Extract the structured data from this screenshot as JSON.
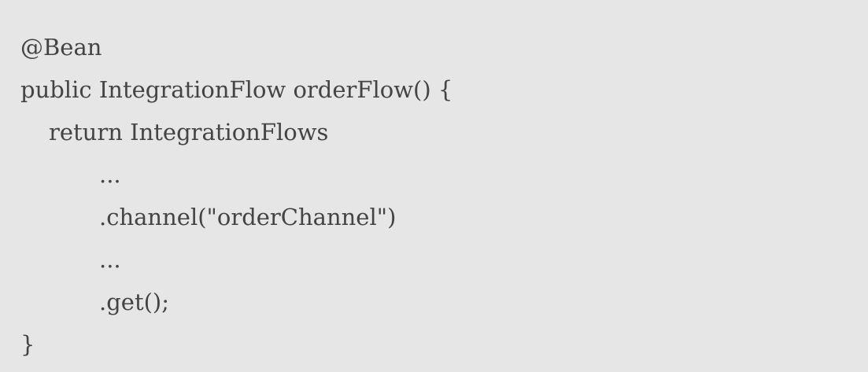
{
  "code": {
    "lines": [
      "@Bean",
      "public IntegrationFlow orderFlow() {",
      "return IntegrationFlows",
      "...",
      ".channel(\"orderChannel\")",
      "...",
      ".get();",
      "}"
    ]
  }
}
